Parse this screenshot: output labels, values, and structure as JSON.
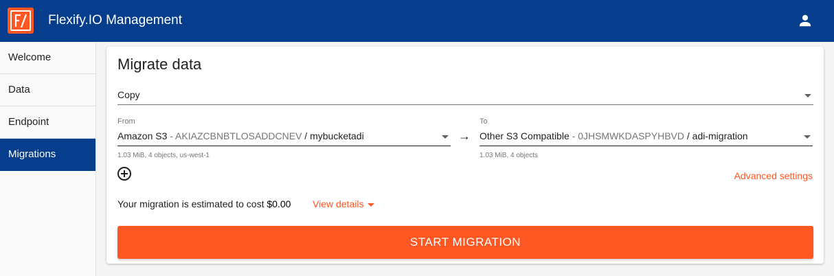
{
  "header": {
    "app_title": "Flexify.IO Management",
    "logo_icon": "flexify-logo-icon",
    "user_icon": "user-icon",
    "colors": {
      "bar": "#063d8c",
      "logo": "#ff5722"
    }
  },
  "sidebar": {
    "items": [
      {
        "label": "Welcome",
        "active": false
      },
      {
        "label": "Data",
        "active": false
      },
      {
        "label": "Endpoint",
        "active": false
      },
      {
        "label": "Migrations",
        "active": true
      }
    ]
  },
  "main": {
    "title": "Migrate data",
    "mode": {
      "value": "Copy"
    },
    "from": {
      "label": "From",
      "provider": "Amazon S3",
      "separator": " - ",
      "access_key": "AKIAZCBNBTLOSADDCNEV",
      "slash": " / ",
      "bucket": "mybucketadi",
      "helper": "1.03 MiB, 4 objects, us-west-1"
    },
    "to": {
      "label": "To",
      "provider": "Other S3 Compatible",
      "separator": " - ",
      "access_key": "0JHSMWKDASPYHBVD",
      "slash": " / ",
      "bucket": "adi-migration",
      "helper": "1.03 MiB, 4 objects"
    },
    "arrow": "→",
    "add_source_icon": "add-circle-icon",
    "advanced_settings": "Advanced settings",
    "estimate_text": "Your migration is estimated to cost ",
    "estimate_cost": "$0.00",
    "view_details": "View details",
    "start_button": "START MIGRATION",
    "accent": "#ff5722"
  }
}
